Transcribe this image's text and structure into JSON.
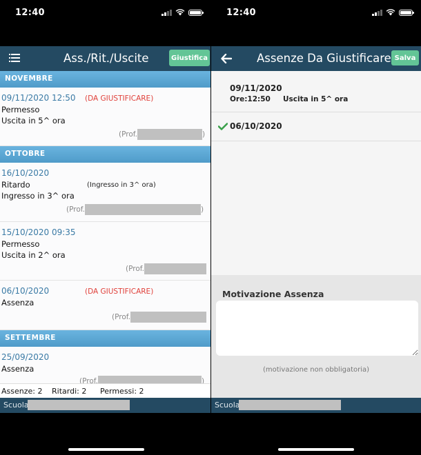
{
  "left": {
    "status_time": "12:40",
    "nav_title": "Ass./Rit./Uscite",
    "justify_button": "Giustifica",
    "sections": [
      {
        "label": "NOVEMBRE",
        "entries": [
          {
            "date": "09/11/2020 12:50",
            "status": "(DA GIUSTIFICARE)",
            "type": "Permesso",
            "detail": "Uscita in 5^ ora",
            "prof_label": "(Prof.",
            "prof_close": ")"
          }
        ]
      },
      {
        "label": "OTTOBRE",
        "entries": [
          {
            "date": "16/10/2020",
            "type": "Ritardo",
            "detail_inline": "(Ingresso in 3^ ora)",
            "detail": "Ingresso in 3^ ora",
            "prof_label": "(Prof.",
            "prof_close": ")"
          },
          {
            "date": "15/10/2020 09:35",
            "type": "Permesso",
            "detail": "Uscita in 2^ ora",
            "prof_label": "(Prof.",
            "prof_close": ""
          },
          {
            "date": "06/10/2020",
            "status": "(DA GIUSTIFICARE)",
            "type": "Assenza",
            "prof_label": "(Prof.",
            "prof_close": ""
          }
        ]
      },
      {
        "label": "SETTEMBRE",
        "entries": [
          {
            "date": "25/09/2020",
            "type": "Assenza",
            "prof_label": "(Prof.",
            "prof_close": ")"
          }
        ]
      }
    ],
    "summary": {
      "absences": "Assenze: 2",
      "late": "Ritardi: 2",
      "permits": "Permessi: 2"
    },
    "footer_label": "Scuola:"
  },
  "right": {
    "status_time": "12:40",
    "nav_title": "Assenze Da Giustificare",
    "save_button": "Salva",
    "items": [
      {
        "date": "09/11/2020",
        "time_label": "Ore:12:50",
        "detail": "Uscita in 5^ ora"
      },
      {
        "date": "06/10/2020",
        "checked": true
      }
    ],
    "motivation_title": "Motivazione Assenza",
    "motivation_note": "(motivazione non obbligatoria)",
    "footer_label": "Scuola:"
  },
  "colors": {
    "navbar": "#244a62",
    "section": "#5aa8d6",
    "green_button": "#63c596",
    "date_blue": "#3a7aa5",
    "warning_red": "#e0403a",
    "check_green": "#3aa04a"
  }
}
